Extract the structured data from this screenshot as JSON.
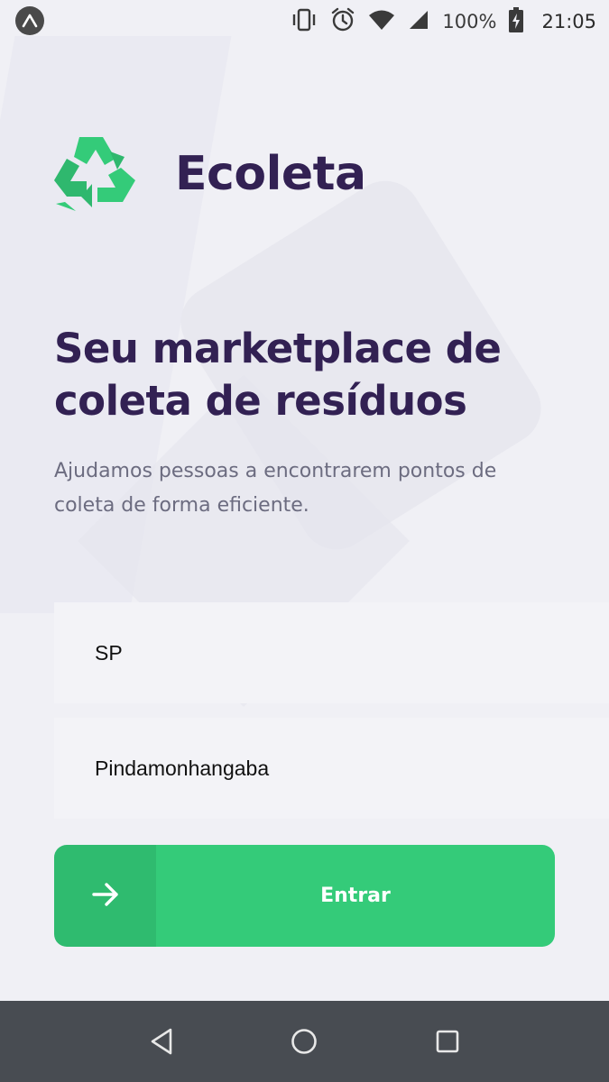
{
  "status_bar": {
    "battery": "100%",
    "time": "21:05",
    "icons": [
      "expo-icon",
      "vibrate-icon",
      "alarm-icon",
      "wifi-icon",
      "signal-icon",
      "battery-charging-icon"
    ]
  },
  "logo": {
    "text": "Ecoleta",
    "icon": "recycle-icon"
  },
  "hero": {
    "title": "Seu marketplace de coleta de resíduos",
    "description": "Ajudamos pessoas a encontrarem pontos de coleta de forma eficiente."
  },
  "form": {
    "uf_value": "SP",
    "city_value": "Pindamonhangaba",
    "enter_label": "Entrar",
    "enter_icon": "arrow-right-icon"
  },
  "nav_bar": {
    "icons": [
      "back-icon",
      "home-icon",
      "recents-icon"
    ]
  },
  "colors": {
    "background": "#f0f0f5",
    "primary_text": "#322153",
    "secondary_text": "#6c6c80",
    "accent": "#34cb79",
    "nav_bar": "#484c52"
  }
}
